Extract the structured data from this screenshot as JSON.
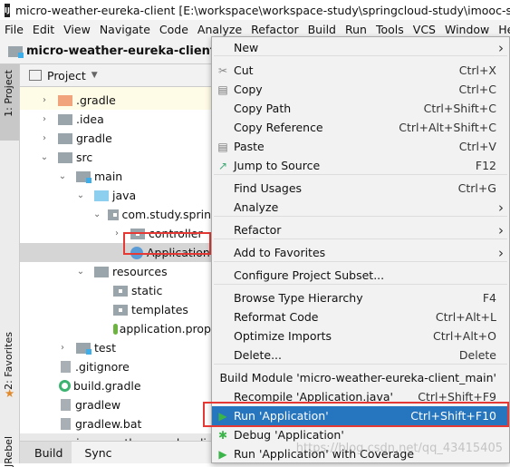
{
  "title": "micro-weather-eureka-client [E:\\workspace\\workspace-study\\springcloud-study\\imooc-sprin",
  "menubar": [
    "File",
    "Edit",
    "View",
    "Navigate",
    "Code",
    "Analyze",
    "Refactor",
    "Build",
    "Run",
    "Tools",
    "VCS",
    "Window",
    "He"
  ],
  "breadcrumb": "micro-weather-eureka-client",
  "side_tabs": {
    "project": "1: Project",
    "favorites": "2: Favorites",
    "jrebel": "JRebel"
  },
  "panel_title": "Project",
  "tree": [
    ".gradle",
    ".idea",
    "gradle",
    "src",
    "main",
    "java",
    "com.study.sprin",
    "controller",
    "Application",
    "resources",
    "static",
    "templates",
    "application.prop",
    "test",
    ".gitignore",
    "build.gradle",
    "gradlew",
    "gradlew.bat",
    "micro-weather-eureka-clie"
  ],
  "bottom_tabs": [
    "Build",
    "Sync"
  ],
  "menu": [
    {
      "label": "New",
      "shortcut": "",
      "submenu": true
    },
    {
      "label": "Cut",
      "shortcut": "Ctrl+X",
      "icon": "scissors-icon"
    },
    {
      "label": "Copy",
      "shortcut": "Ctrl+C",
      "icon": "copy-icon"
    },
    {
      "label": "Copy Path",
      "shortcut": "Ctrl+Shift+C"
    },
    {
      "label": "Copy Reference",
      "shortcut": "Ctrl+Alt+Shift+C"
    },
    {
      "label": "Paste",
      "shortcut": "Ctrl+V",
      "icon": "paste-icon"
    },
    {
      "label": "Jump to Source",
      "shortcut": "F12",
      "icon": "jump-icon"
    },
    {
      "label": "Find Usages",
      "shortcut": "Ctrl+G"
    },
    {
      "label": "Analyze",
      "shortcut": "",
      "submenu": true
    },
    {
      "label": "Refactor",
      "shortcut": "",
      "submenu": true
    },
    {
      "label": "Add to Favorites",
      "shortcut": "",
      "submenu": true
    },
    {
      "label": "Configure Project Subset...",
      "shortcut": ""
    },
    {
      "label": "Browse Type Hierarchy",
      "shortcut": "F4"
    },
    {
      "label": "Reformat Code",
      "shortcut": "Ctrl+Alt+L"
    },
    {
      "label": "Optimize Imports",
      "shortcut": "Ctrl+Alt+O"
    },
    {
      "label": "Delete...",
      "shortcut": "Delete"
    },
    {
      "label": "Build Module 'micro-weather-eureka-client_main'",
      "shortcut": ""
    },
    {
      "label": "Recompile 'Application.java'",
      "shortcut": "Ctrl+Shift+F9"
    },
    {
      "label": "Run 'Application'",
      "shortcut": "Ctrl+Shift+F10",
      "icon": "run-icon",
      "selected": true
    },
    {
      "label": "Debug 'Application'",
      "shortcut": "",
      "icon": "debug-icon"
    },
    {
      "label": "Run 'Application' with Coverage",
      "shortcut": "",
      "icon": "coverage-icon"
    }
  ],
  "watermark": "https://blog.csdn.net/qq_43415405",
  "colors": {
    "selection": "#2675bf",
    "highlight_box": "#e53935"
  }
}
